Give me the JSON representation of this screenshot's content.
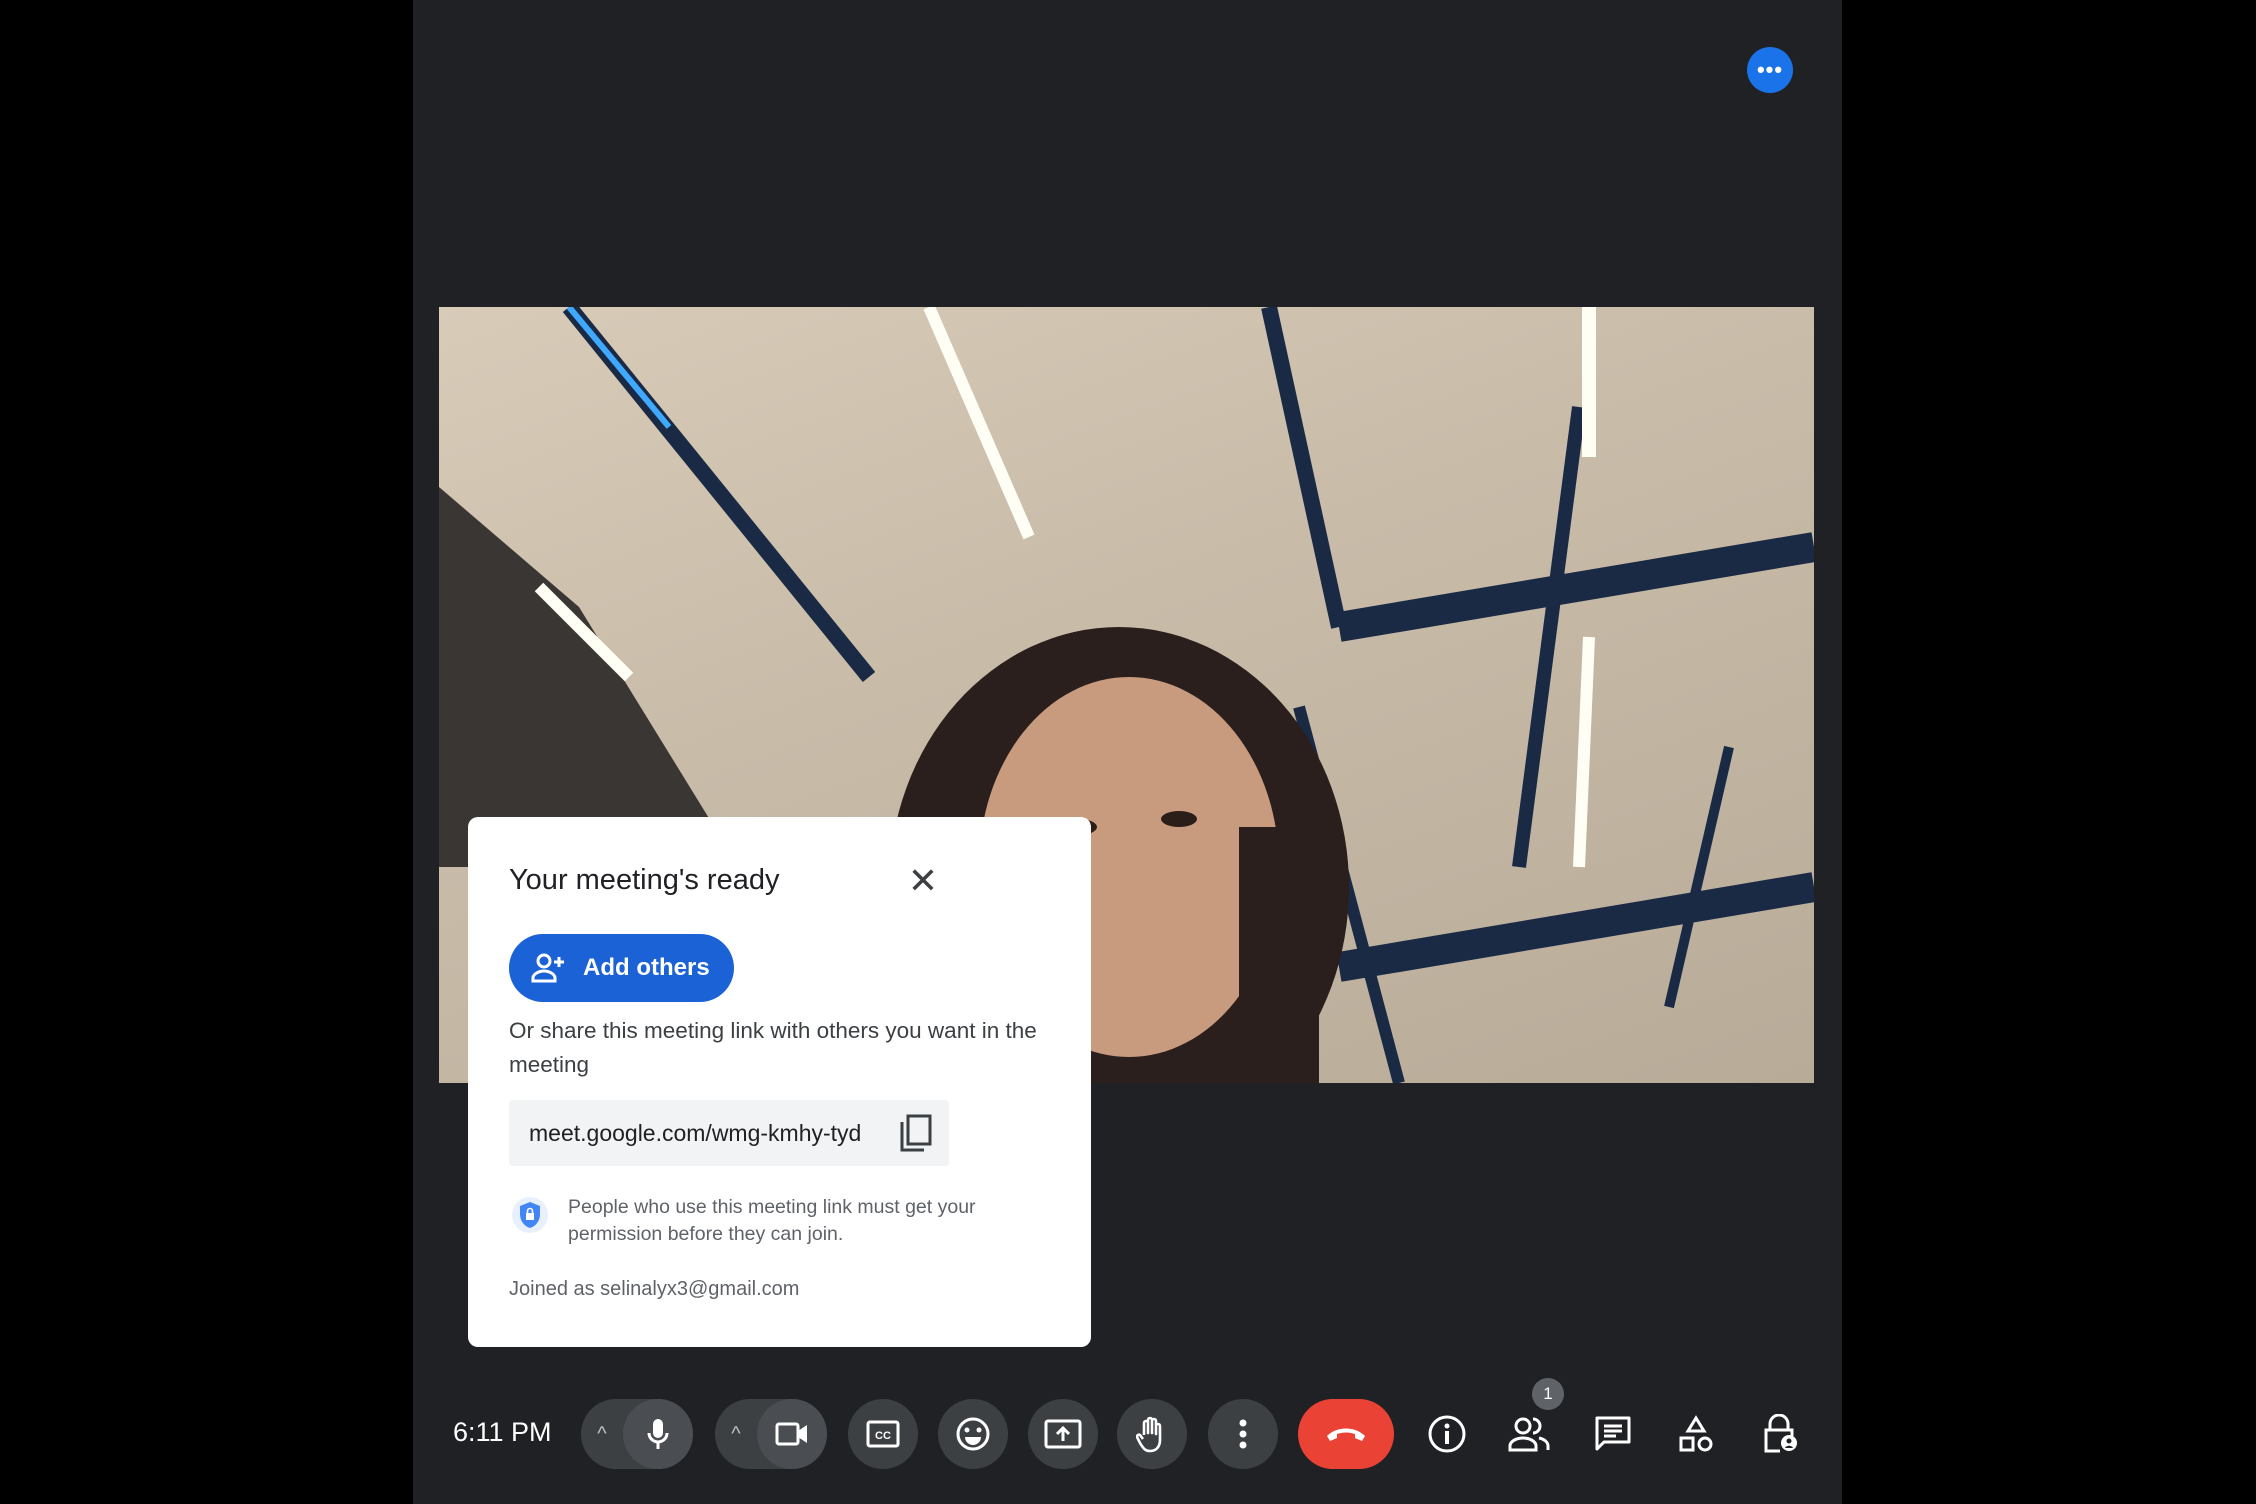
{
  "top_more_label": "•••",
  "dialog": {
    "title": "Your meeting's ready",
    "close_label": "✕",
    "add_others_label": "Add others",
    "description": "Or share this meeting link with others you want in the meeting",
    "meeting_link": "meet.google.com/wmg-kmhy-tyd",
    "permission_note": "People who use this meeting link must get your permission before they can join.",
    "joined_as": "Joined as selinalyx3@gmail.com"
  },
  "toolbar": {
    "time": "6:11 PM",
    "mic_chevron": "^",
    "cam_chevron": "^",
    "people_badge": "1"
  },
  "colors": {
    "accent": "#1a73e8",
    "end_call": "#ea4335",
    "background": "#202124"
  }
}
